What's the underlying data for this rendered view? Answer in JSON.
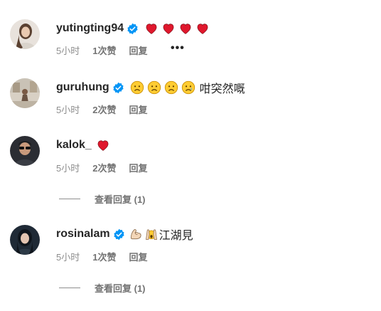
{
  "comments": [
    {
      "username": "yutingting94",
      "verified": true,
      "emojis": [
        "red-heart",
        "red-heart",
        "red-heart",
        "red-heart"
      ],
      "text": "",
      "time": "5小时",
      "likes": "1次赞",
      "reply": "回复",
      "more": "•••"
    },
    {
      "username": "guruhung",
      "verified": true,
      "emojis": [
        "sad-face",
        "sad-face",
        "sad-face",
        "crying-face"
      ],
      "text": "咁突然嘅",
      "time": "5小时",
      "likes": "2次赞",
      "reply": "回复"
    },
    {
      "username": "kalok_",
      "verified": false,
      "emojis": [
        "red-heart"
      ],
      "text": "",
      "time": "5小时",
      "likes": "2次赞",
      "reply": "回复",
      "view_replies": "查看回复 (1)"
    },
    {
      "username": "rosinalam",
      "verified": true,
      "emojis": [
        "flexed-biceps",
        "hands-raised"
      ],
      "text": "江湖見",
      "time": "5小时",
      "likes": "1次赞",
      "reply": "回复",
      "view_replies": "查看回复 (1)"
    }
  ],
  "colors": {
    "verified": "#0095f6",
    "heart": "#e0182d",
    "meta_text": "#737373",
    "username": "#262626"
  }
}
